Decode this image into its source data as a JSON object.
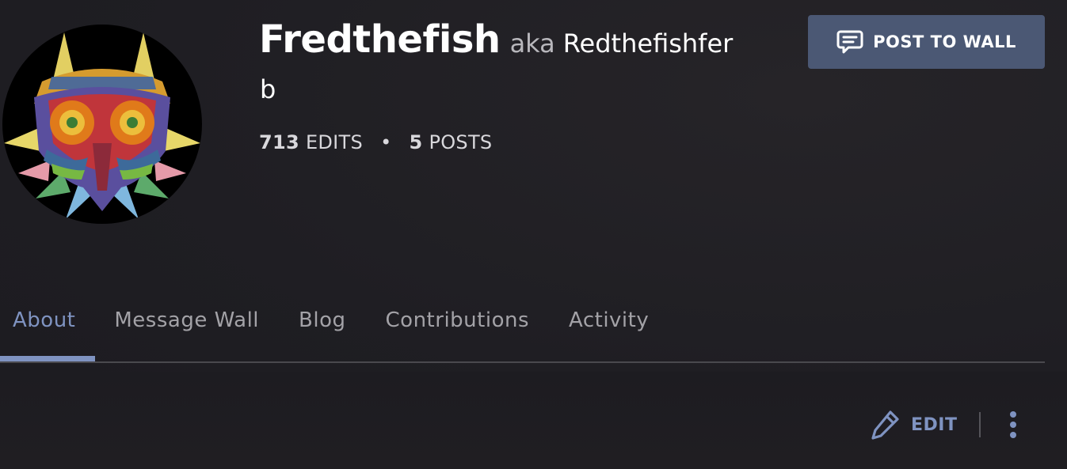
{
  "profile": {
    "username": "Fredthefish",
    "aka_label": "aka",
    "aka_name_line1": "Redthefishfer",
    "aka_name_line2": "b",
    "avatar_icon": "majoras-mask-avatar"
  },
  "stats": {
    "edits_count": "713",
    "edits_label": "EDITS",
    "separator": "•",
    "posts_count": "5",
    "posts_label": "POSTS"
  },
  "actions": {
    "post_to_wall_label": "POST TO WALL",
    "post_to_wall_icon": "speech-bubble-icon",
    "edit_label": "EDIT",
    "edit_icon": "pencil-icon",
    "more_icon": "vertical-ellipsis-icon"
  },
  "tabs": [
    {
      "label": "About",
      "active": true
    },
    {
      "label": "Message Wall",
      "active": false
    },
    {
      "label": "Blog",
      "active": false
    },
    {
      "label": "Contributions",
      "active": false
    },
    {
      "label": "Activity",
      "active": false
    }
  ],
  "colors": {
    "background": "#1f1e23",
    "accent": "#7f93c1",
    "button_bg": "#4b5874",
    "tab_inactive": "#a3a2a7"
  }
}
